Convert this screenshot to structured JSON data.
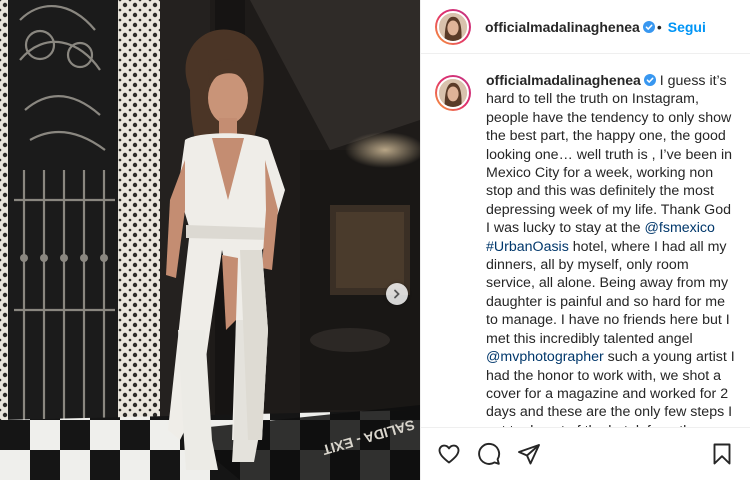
{
  "post": {
    "username": "officialmadalinaghenea",
    "follow_label": "Segui",
    "caption_parts": [
      " I guess it’s hard to tell the truth on Instagram, people have the tendency to only show the best part, the happy one, the good looking one… well truth is , I’ve been in Mexico City for a week, working non stop and this was definitely the most depressing week of my life. Thank God I was lucky to stay at the ",
      "@fsmexico",
      " ",
      "#UrbanOasis",
      " hotel, where I had all my dinners, all by myself, only room service, all alone. Being away from my daughter is painful and so hard for me to manage. I have no friends here but I met this incredibly talented angel ",
      "@mvphotographer",
      " such a young artist I had the honor to work with, we shot a cover for a magazine and worked for 2 days and these are the only few steps I got to do out of the hotel, from the"
    ]
  },
  "photo": {
    "floor_sign": "SALIDA - EXIT"
  },
  "icons": {
    "next": "chevron-right-icon",
    "like": "heart-icon",
    "comment": "comment-icon",
    "share": "paper-plane-icon",
    "save": "bookmark-icon",
    "verified": "verified-badge-icon"
  },
  "colors": {
    "link": "#00376b",
    "follow": "#0095f6",
    "verified": "#3897f0",
    "text": "#262626"
  }
}
